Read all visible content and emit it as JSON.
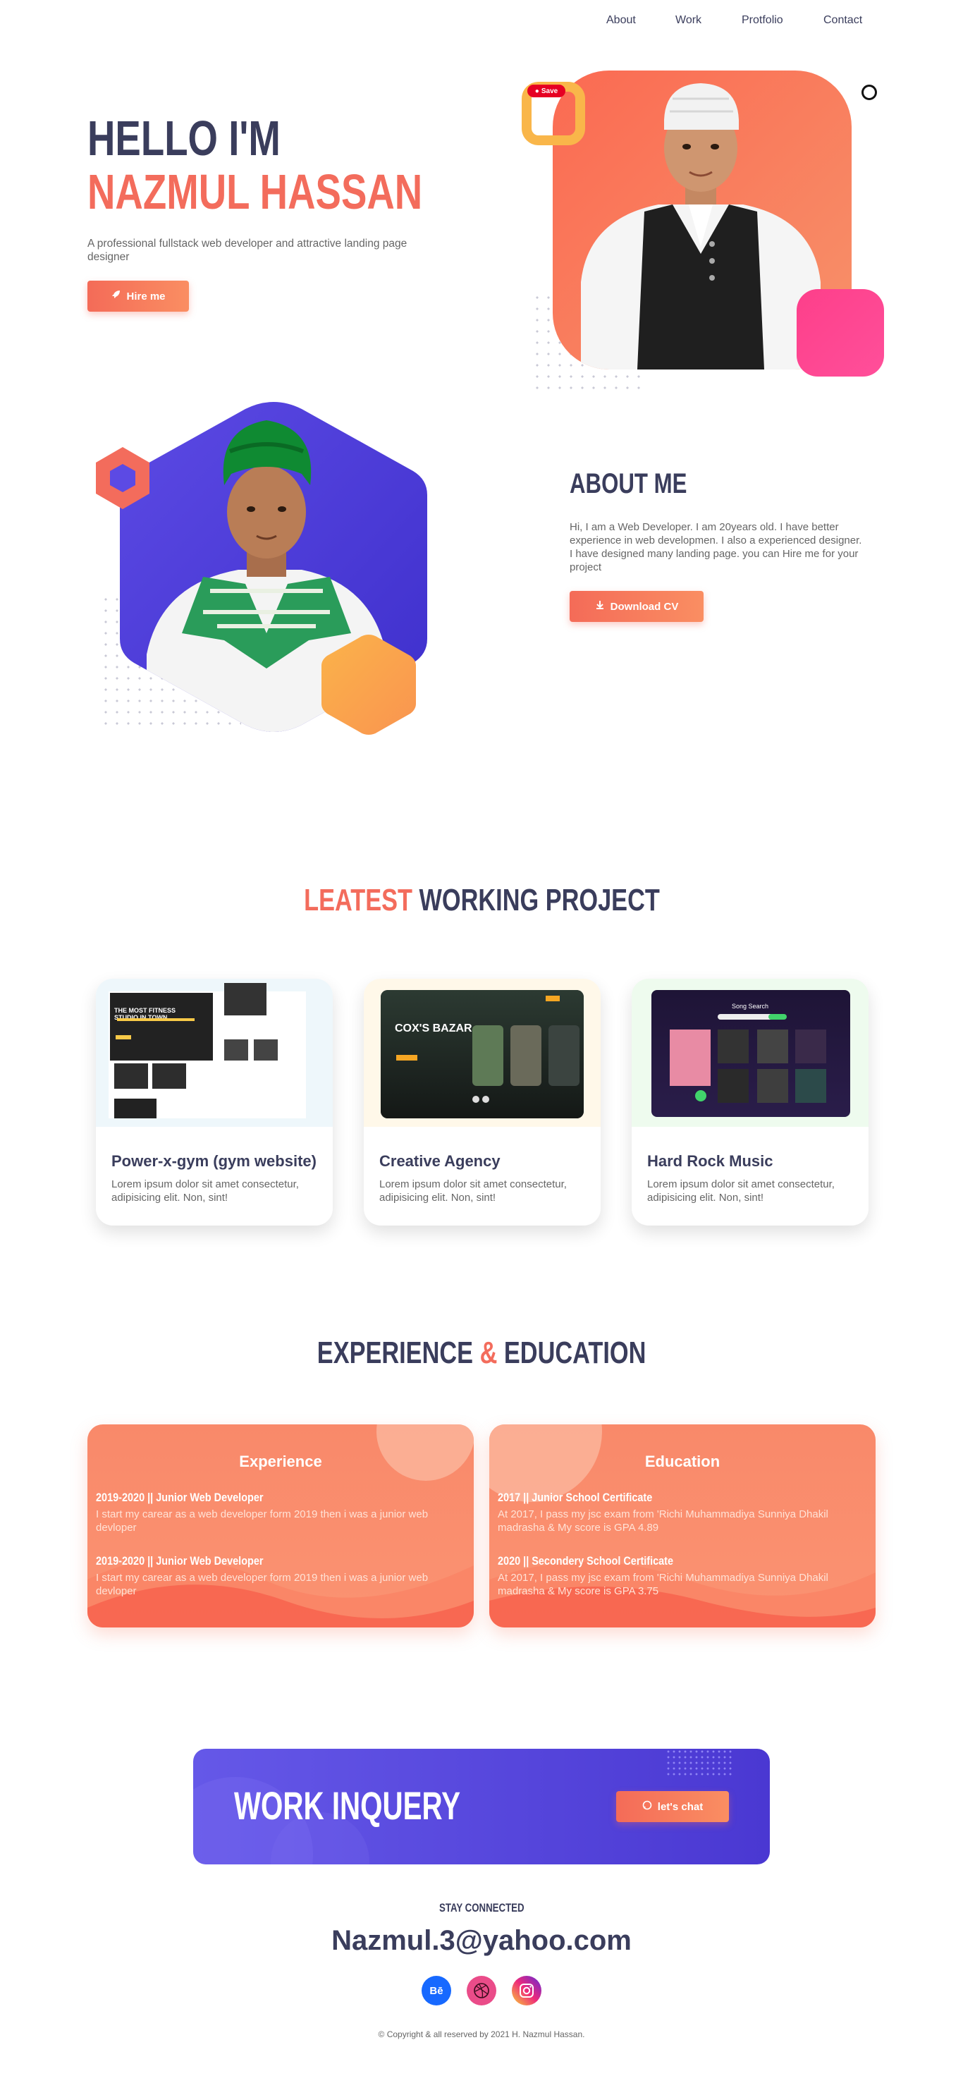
{
  "nav": {
    "items": [
      {
        "label": "About"
      },
      {
        "label": "Work"
      },
      {
        "label": "Protfolio"
      },
      {
        "label": "Contact"
      }
    ]
  },
  "hero": {
    "greeting": "HELLO I'M",
    "name": "NAZMUL HASSAN",
    "tagline": "A professional fullstack web developer and attractive landing page designer",
    "hire_label": "Hire me",
    "save_label": "Save"
  },
  "about": {
    "title": "ABOUT ME",
    "text": "Hi, I am a Web Developer. I am 20years old. I have better experience in web developmen. I also a experienced designer. I have designed many landing page. you can Hire me for your project",
    "download_label": "Download CV"
  },
  "projects": {
    "title_accent": "LEATEST",
    "title_rest": "WORKING PROJECT",
    "cards": [
      {
        "title": "Power-x-gym (gym website)",
        "desc": "Lorem ipsum dolor sit amet consectetur, adipisicing elit. Non, sint!",
        "thumb_heading": "THE MOST FITNESS STUDIO IN TOWN"
      },
      {
        "title": "Creative Agency",
        "desc": "Lorem ipsum dolor sit amet consectetur, adipisicing elit. Non, sint!",
        "thumb_heading": "COX'S BAZAR"
      },
      {
        "title": "Hard Rock Music",
        "desc": "Lorem ipsum dolor sit amet consectetur, adipisicing elit. Non, sint!",
        "thumb_heading": "Song Search"
      }
    ]
  },
  "experience": {
    "title_left": "EXPERIENCE",
    "title_amp": "&",
    "title_right": "EDUCATION",
    "exp": {
      "heading": "Experience",
      "items": [
        {
          "title": "2019-2020 || Junior Web Developer",
          "text": "I start my carear as a web developer form 2019 then i was a junior web devloper"
        },
        {
          "title": "2019-2020 || Junior Web Developer",
          "text": "I start my carear as a web developer form 2019 then i was a junior web devloper"
        }
      ]
    },
    "edu": {
      "heading": "Education",
      "items": [
        {
          "title": "2017 || Junior School Certificate",
          "text": "At 2017, I pass my jsc exam from 'Richi Muhammadiya Sunniya Dhakil madrasha & My score is GPA 4.89"
        },
        {
          "title": "2020 || Secondery School Certificate",
          "text": "At 2017, I pass my jsc exam from 'Richi Muhammadiya Sunniya Dhakil madrasha & My score is GPA 3.75"
        }
      ]
    }
  },
  "inquiry": {
    "title": "WORK INQUERY",
    "chat_label": "let's chat"
  },
  "footer": {
    "stay": "STAY CONNECTED",
    "email": "Nazmul.3@yahoo.com",
    "social": [
      {
        "name": "behance",
        "label": "Bē",
        "color": "#1769ff"
      },
      {
        "name": "dribbble",
        "label": "",
        "color": "#ea4c89"
      },
      {
        "name": "instagram",
        "label": "",
        "color": "#d6249f"
      }
    ],
    "copyright": "© Copyright & all reserved by 2021 H. Nazmul Hassan."
  },
  "colors": {
    "accent": "#f36c5c",
    "navy": "#3a3d5c",
    "purple": "#4f3fd8",
    "pink": "#fd3f8a",
    "yellow": "#f9b64a"
  }
}
